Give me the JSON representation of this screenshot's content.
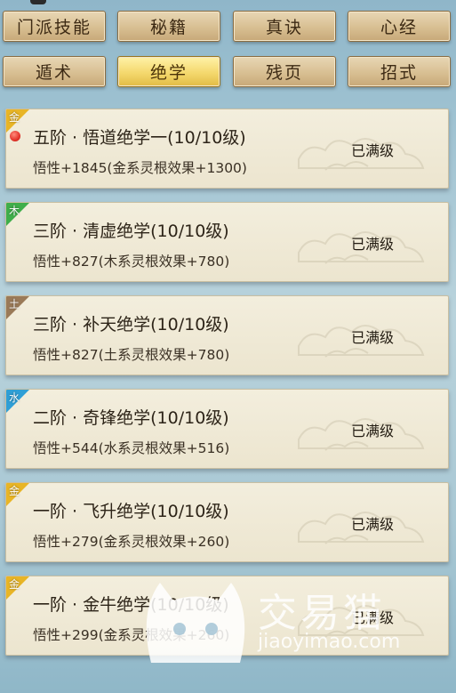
{
  "tabs": [
    {
      "label": "门派技能",
      "active": false
    },
    {
      "label": "秘籍",
      "active": false
    },
    {
      "label": "真诀",
      "active": false
    },
    {
      "label": "心经",
      "active": false
    },
    {
      "label": "遁术",
      "active": false
    },
    {
      "label": "绝学",
      "active": true
    },
    {
      "label": "残页",
      "active": false
    },
    {
      "label": "招式",
      "active": false
    }
  ],
  "skills": [
    {
      "element": "金",
      "element_color": "#e8b526",
      "title": "五阶 · 悟道绝学一(10/10级)",
      "stat": "悟性+1845(金系灵根效果+1300)",
      "status": "已满级",
      "notify": true
    },
    {
      "element": "木",
      "element_color": "#3fae4a",
      "title": "三阶 · 清虚绝学(10/10级)",
      "stat": "悟性+827(木系灵根效果+780)",
      "status": "已满级",
      "notify": false
    },
    {
      "element": "土",
      "element_color": "#9a7a58",
      "title": "三阶 · 补天绝学(10/10级)",
      "stat": "悟性+827(土系灵根效果+780)",
      "status": "已满级",
      "notify": false
    },
    {
      "element": "水",
      "element_color": "#2f9fd6",
      "title": "二阶 · 奇锋绝学(10/10级)",
      "stat": "悟性+544(水系灵根效果+516)",
      "status": "已满级",
      "notify": false
    },
    {
      "element": "金",
      "element_color": "#e8b526",
      "title": "一阶 · 飞升绝学(10/10级)",
      "stat": "悟性+279(金系灵根效果+260)",
      "status": "已满级",
      "notify": false
    },
    {
      "element": "金",
      "element_color": "#e8b526",
      "title": "一阶 · 金牛绝学(10/10级)",
      "stat": "悟性+299(金系灵根效果+260)",
      "status": "已满级",
      "notify": false
    }
  ],
  "watermark": {
    "brand": "交易猫",
    "url": "jiaoyimao.com"
  }
}
